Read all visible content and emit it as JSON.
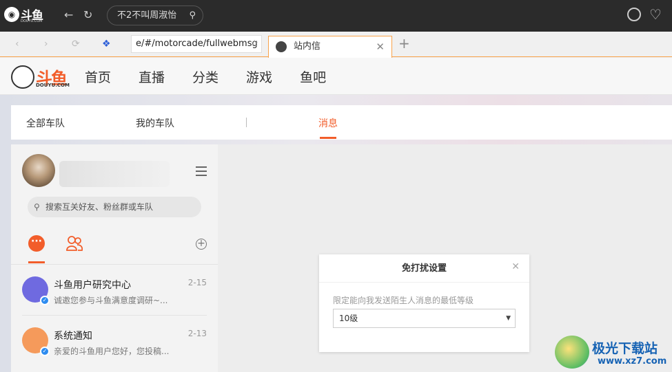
{
  "app": {
    "logo_text": "斗鱼",
    "logo_sub": "DOUYU.COM",
    "search_value": "不2不叫周淑怡"
  },
  "browser": {
    "address": "e/#/motorcade/fullwebmsg",
    "tab_title": "站内信"
  },
  "site": {
    "logo_text": "斗鱼",
    "logo_sub": "DOUYU.COM",
    "nav": [
      "首页",
      "直播",
      "分类",
      "游戏",
      "鱼吧"
    ]
  },
  "subtabs": {
    "all": "全部车队",
    "mine": "我的车队",
    "messages": "消息"
  },
  "panel": {
    "search_placeholder": "搜索互关好友、粉丝群或车队",
    "items": [
      {
        "title": "斗鱼用户研究中心",
        "preview": "诚邀您参与斗鱼满意度调研~...",
        "date": "2-15"
      },
      {
        "title": "系统通知",
        "preview": "亲爱的斗鱼用户您好，您投稿...",
        "date": "2-13"
      }
    ]
  },
  "dialog": {
    "title": "免打扰设置",
    "label": "限定能向我发送陌生人消息的最低等级",
    "selected": "10级"
  },
  "watermark": {
    "line1": "极光下载站",
    "line2": "www.xz7.com"
  },
  "colors": {
    "accent": "#f25d2a",
    "appbar": "#2b2b2b",
    "verified": "#2d8cf0"
  }
}
